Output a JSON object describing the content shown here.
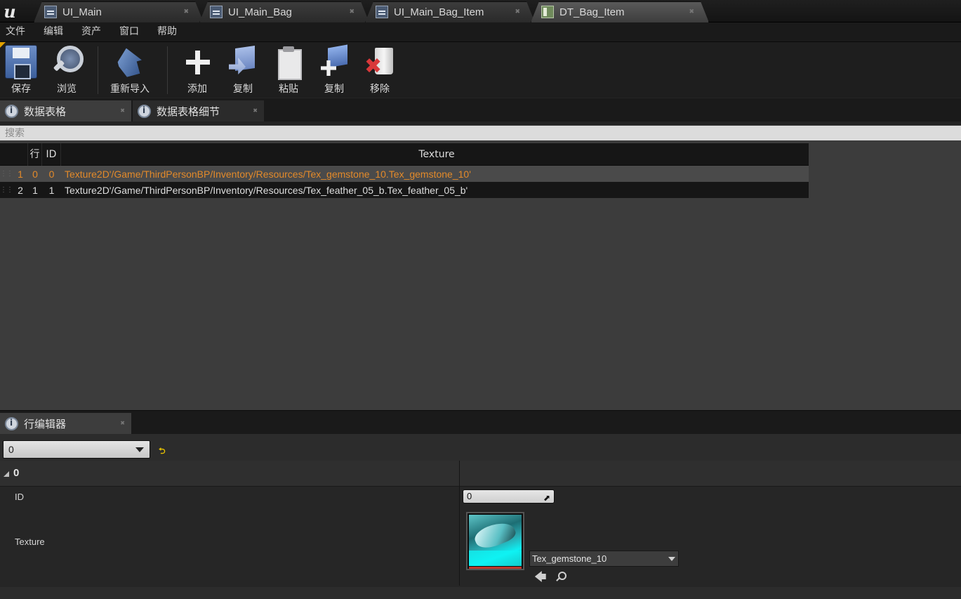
{
  "document_tabs": [
    {
      "label": "UI_Main",
      "type": "widget-blueprint"
    },
    {
      "label": "UI_Main_Bag",
      "type": "widget-blueprint"
    },
    {
      "label": "UI_Main_Bag_Item",
      "type": "widget-blueprint"
    },
    {
      "label": "DT_Bag_Item",
      "type": "data-table",
      "active": true
    }
  ],
  "menu": [
    "文件",
    "编辑",
    "资产",
    "窗口",
    "帮助"
  ],
  "toolbar": {
    "save": "保存",
    "browse": "浏览",
    "reimport": "重新导入",
    "add": "添加",
    "copy": "复制",
    "paste": "粘贴",
    "duplicate": "复制",
    "remove": "移除"
  },
  "panel_tabs": {
    "data_table": "数据表格",
    "data_table_details": "数据表格细节",
    "row_editor": "行编辑器"
  },
  "search": {
    "placeholder": "搜索"
  },
  "table": {
    "columns": {
      "row": "行",
      "name": "",
      "id": "ID",
      "texture": "Texture"
    },
    "rows": [
      {
        "row": "1",
        "name": "0",
        "id": "0",
        "texture": "Texture2D'/Game/ThirdPersonBP/Inventory/Resources/Tex_gemstone_10.Tex_gemstone_10'",
        "selected": true
      },
      {
        "row": "2",
        "name": "1",
        "id": "1",
        "texture": "Texture2D'/Game/ThirdPersonBP/Inventory/Resources/Tex_feather_05_b.Tex_feather_05_b'",
        "selected": false
      }
    ]
  },
  "row_editor": {
    "selected_row": "0",
    "category": "0",
    "properties": {
      "id_label": "ID",
      "id_value": "0",
      "texture_label": "Texture",
      "texture_value": "Tex_gemstone_10"
    }
  },
  "colors": {
    "selected_row_text": "#e38a2a",
    "reset_arrow": "#e8c300"
  }
}
